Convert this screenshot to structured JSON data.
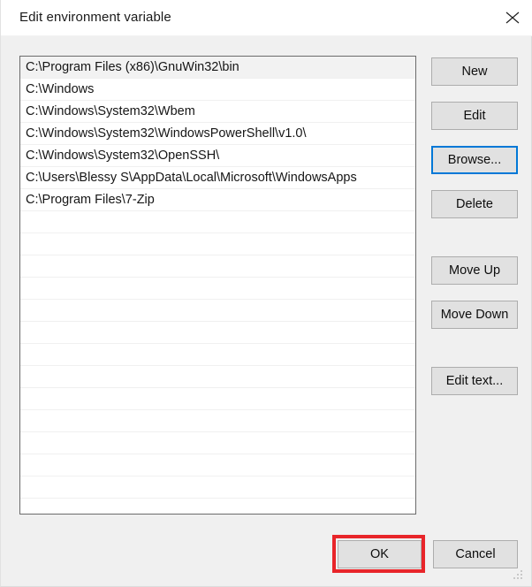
{
  "window": {
    "title": "Edit environment variable",
    "close_icon": "close-icon"
  },
  "list": {
    "selected_index": 0,
    "entries": [
      "C:\\Program Files (x86)\\GnuWin32\\bin",
      "C:\\Windows",
      "C:\\Windows\\System32\\Wbem",
      "C:\\Windows\\System32\\WindowsPowerShell\\v1.0\\",
      "C:\\Windows\\System32\\OpenSSH\\",
      "C:\\Users\\Blessy S\\AppData\\Local\\Microsoft\\WindowsApps",
      "C:\\Program Files\\7-Zip"
    ],
    "empty_row_count": 13
  },
  "side_buttons": [
    {
      "label": "New",
      "name": "new-button",
      "focused": false
    },
    {
      "label": "Edit",
      "name": "edit-button",
      "focused": false
    },
    {
      "label": "Browse...",
      "name": "browse-button",
      "focused": true
    },
    {
      "label": "Delete",
      "name": "delete-button",
      "focused": false
    },
    {
      "label": "Move Up",
      "name": "move-up-button",
      "focused": false
    },
    {
      "label": "Move Down",
      "name": "move-down-button",
      "focused": false
    },
    {
      "label": "Edit text...",
      "name": "edit-text-button",
      "focused": false
    }
  ],
  "footer": {
    "ok_label": "OK",
    "cancel_label": "Cancel"
  },
  "annotation": {
    "target": "OK",
    "color": "#e8252a"
  },
  "colors": {
    "dialog_background": "#f0f0f0",
    "titlebar_background": "#ffffff",
    "listbox_background": "#ffffff",
    "listbox_border": "#6b6b6b",
    "row_selected_background": "#f2f2f2",
    "button_face": "#e1e1e1",
    "button_border": "#adadad",
    "focus_ring": "#0078d7",
    "annotation_red": "#e8252a",
    "text": "#161616"
  }
}
